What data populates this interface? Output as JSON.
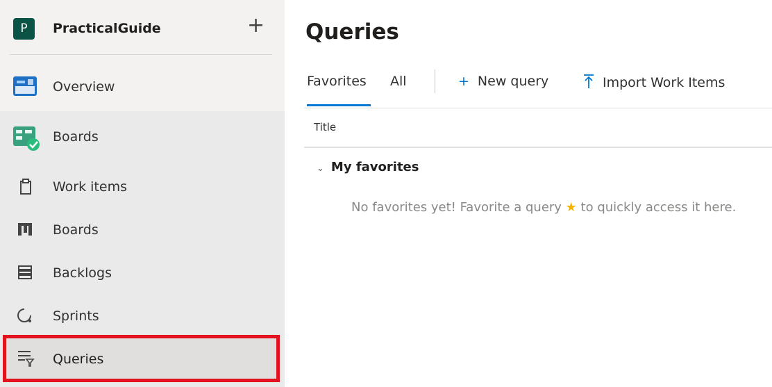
{
  "colors": {
    "accent": "#0078d4",
    "project_badge": "#0b5345",
    "highlight": "#e3121f",
    "star": "#f2b400"
  },
  "project": {
    "badge_letter": "P",
    "name": "PracticalGuide",
    "add_icon": "plus-icon"
  },
  "sidebar": {
    "items": [
      {
        "label": "Overview",
        "icon": "overview-icon"
      },
      {
        "label": "Boards",
        "icon": "boards-hub-icon"
      },
      {
        "label": "Work items",
        "icon": "work-items-icon"
      },
      {
        "label": "Boards",
        "icon": "boards-icon"
      },
      {
        "label": "Backlogs",
        "icon": "backlogs-icon"
      },
      {
        "label": "Sprints",
        "icon": "sprints-icon"
      },
      {
        "label": "Queries",
        "icon": "queries-icon",
        "selected": true
      }
    ]
  },
  "main": {
    "title": "Queries",
    "tabs": [
      {
        "label": "Favorites",
        "selected": true
      },
      {
        "label": "All"
      }
    ],
    "commands": {
      "new_query": "New query",
      "import_work_items": "Import Work Items"
    },
    "table": {
      "column_title": "Title"
    },
    "group": {
      "label": "My favorites",
      "icon": "chevron-down-icon"
    },
    "empty_message": {
      "before_star": "No favorites yet! Favorite a query ",
      "star": "★",
      "after_star": " to quickly access it here."
    }
  }
}
